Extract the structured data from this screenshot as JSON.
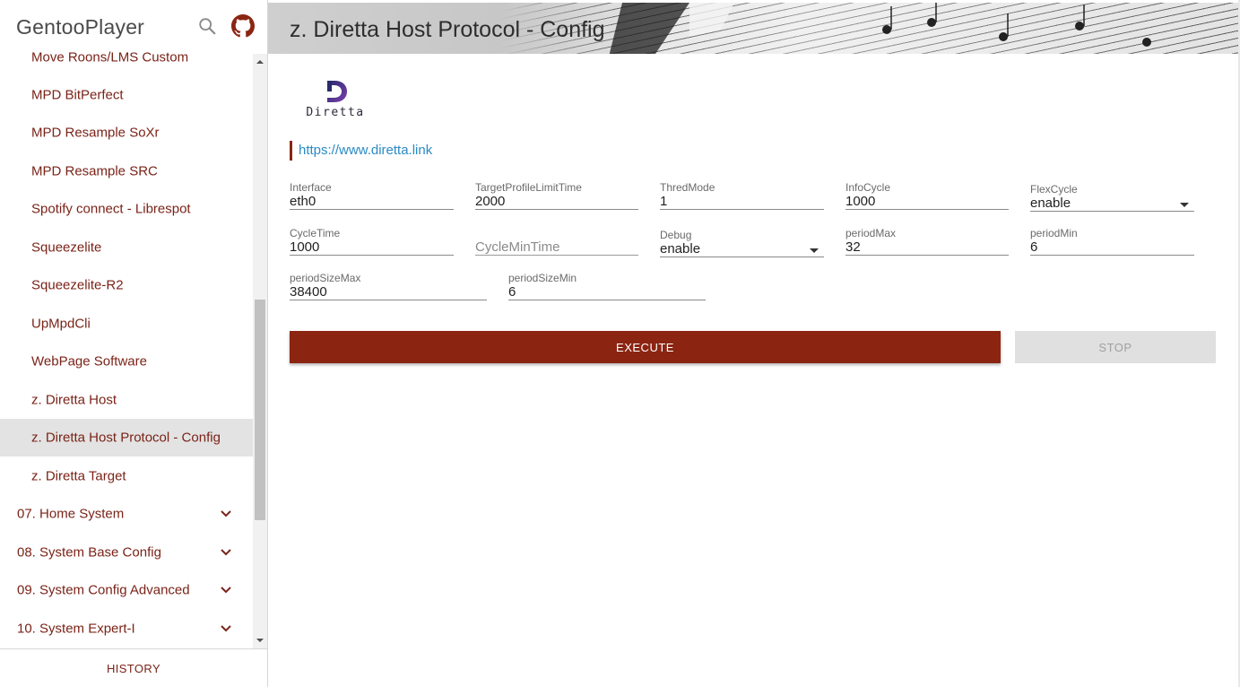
{
  "app": {
    "title": "GentooPlayer"
  },
  "header_icons": {
    "search": "search-icon",
    "github": "github-icon"
  },
  "menu": {
    "items": [
      {
        "label": "Move Roons/LMS Custom",
        "kind": "sub"
      },
      {
        "label": "MPD BitPerfect",
        "kind": "sub"
      },
      {
        "label": "MPD Resample SoXr",
        "kind": "sub"
      },
      {
        "label": "MPD Resample SRC",
        "kind": "sub"
      },
      {
        "label": "Spotify connect - Librespot",
        "kind": "sub"
      },
      {
        "label": "Squeezelite",
        "kind": "sub"
      },
      {
        "label": "Squeezelite-R2",
        "kind": "sub"
      },
      {
        "label": "UpMpdCli",
        "kind": "sub"
      },
      {
        "label": "WebPage Software",
        "kind": "sub"
      },
      {
        "label": "z. Diretta Host",
        "kind": "sub"
      },
      {
        "label": "z. Diretta Host Protocol - Config",
        "kind": "sub",
        "active": true
      },
      {
        "label": "z. Diretta Target",
        "kind": "sub"
      },
      {
        "label": "07. Home System",
        "kind": "group"
      },
      {
        "label": "08. System Base Config",
        "kind": "group"
      },
      {
        "label": "09. System Config Advanced",
        "kind": "group"
      },
      {
        "label": "10. System Expert-I",
        "kind": "group"
      }
    ]
  },
  "footer": {
    "history_label": "HISTORY"
  },
  "page": {
    "title": "z. Diretta Host Protocol - Config",
    "logo_text": "Diretta",
    "link": "https://www.diretta.link"
  },
  "form": {
    "interface": {
      "label": "Interface",
      "value": "eth0"
    },
    "target_profile_limit_time": {
      "label": "TargetProfileLimitTime",
      "value": "2000"
    },
    "thred_mode": {
      "label": "ThredMode",
      "value": "1"
    },
    "info_cycle": {
      "label": "InfoCycle",
      "value": "1000"
    },
    "flex_cycle": {
      "label": "FlexCycle",
      "value": "enable"
    },
    "cycle_time": {
      "label": "CycleTime",
      "value": "1000"
    },
    "cycle_min_time": {
      "placeholder": "CycleMinTime"
    },
    "debug": {
      "label": "Debug",
      "value": "enable"
    },
    "period_max": {
      "label": "periodMax",
      "value": "32"
    },
    "period_min": {
      "label": "periodMin",
      "value": "6"
    },
    "period_size_max": {
      "label": "periodSizeMax",
      "value": "38400"
    },
    "period_size_min": {
      "label": "periodSizeMin",
      "value": "6"
    }
  },
  "actions": {
    "execute_label": "EXECUTE",
    "stop_label": "STOP"
  },
  "colors": {
    "accent": "#8b2512",
    "menu_text": "#7a2318",
    "link": "#2a8bc5",
    "active_bg": "#e3e3e3"
  }
}
